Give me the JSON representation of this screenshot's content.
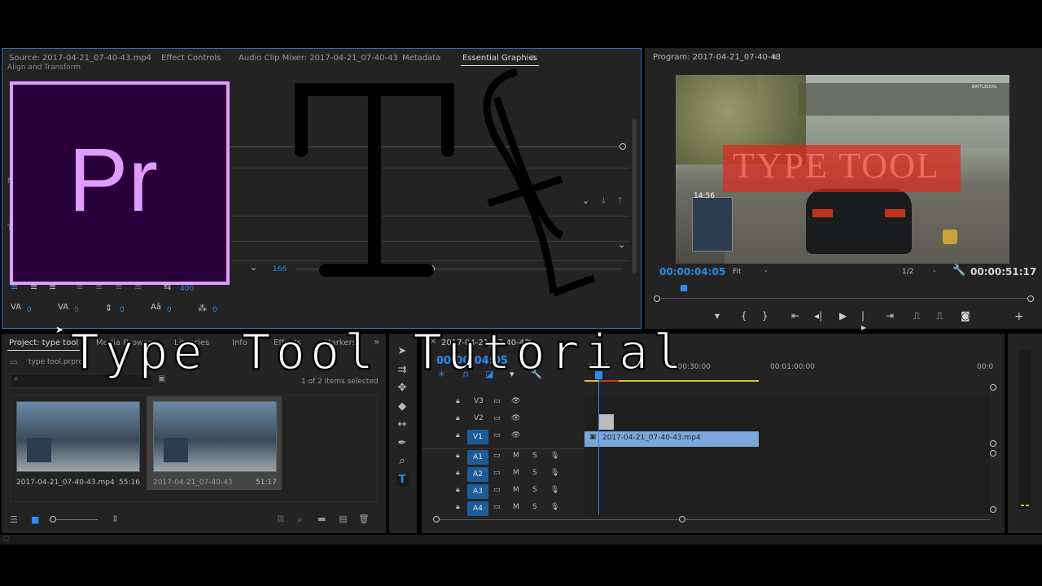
{
  "source_panel": {
    "tabs": [
      "Source: 2017-04-21_07-40-43.mp4",
      "Effect Controls",
      "Audio Clip Mixer: 2017-04-21_07-40-43",
      "Metadata",
      "Essential Graphics"
    ],
    "section_label": "Align and Transform",
    "leading_value": "400",
    "tracking_value": "166",
    "kerning_value": "0",
    "tracking2_value": "0",
    "baseline_value": "0",
    "tsume_value": "0",
    "caps_value": "0",
    "partial_m": "M",
    "partial_t": "T"
  },
  "logo": {
    "text": "Pr",
    "bg": "#2a003b",
    "border": "#e09cff"
  },
  "program_panel": {
    "title": "Program: 2017-04-21_07-40-43",
    "timecode_left": "00:00:04:05",
    "fit": "Fit",
    "quality": "1/2",
    "timecode_right": "00:00:51:17",
    "video_overlay_text": "TYPE TOOL",
    "hud_time": "14:56",
    "hud_corner": "BATTLEDOG"
  },
  "project_panel": {
    "tabs": [
      "Project: type tool",
      "Media Browser",
      "Libraries",
      "Info",
      "Effects",
      "Markers"
    ],
    "project_file": "type tool.prproj",
    "selection_info": "1 of 2 items selected",
    "items": [
      {
        "name": "2017-04-21_07-40-43.mp4",
        "duration": "55:16"
      },
      {
        "name": "2017-04-21_07-40-43",
        "duration": "51:17"
      }
    ]
  },
  "timeline": {
    "sequence_tab": "2017-04-21_07-40-43",
    "timecode": "00:00:04:05",
    "ruler": [
      "00:00",
      "00:00:30:00",
      "00:01:00:00",
      "00:0"
    ],
    "tracks": [
      {
        "target": "V3",
        "kind": "video"
      },
      {
        "target": "V2",
        "kind": "video"
      },
      {
        "target": "V1",
        "kind": "video",
        "targeted": true
      },
      {
        "target": "A1",
        "kind": "audio",
        "targeted": true
      },
      {
        "target": "A2",
        "kind": "audio",
        "targeted": true
      },
      {
        "target": "A3",
        "kind": "audio",
        "targeted": true
      },
      {
        "target": "A4",
        "kind": "audio",
        "targeted": true
      }
    ],
    "clip_name": "2017-04-21_07-40-43.mp4",
    "mute": "M",
    "solo": "S"
  },
  "overlay": {
    "title": "Type Tool Tutorial"
  },
  "colors": {
    "accent": "#2d8ceb",
    "panel": "#232323",
    "clip": "#7aa6d8"
  }
}
